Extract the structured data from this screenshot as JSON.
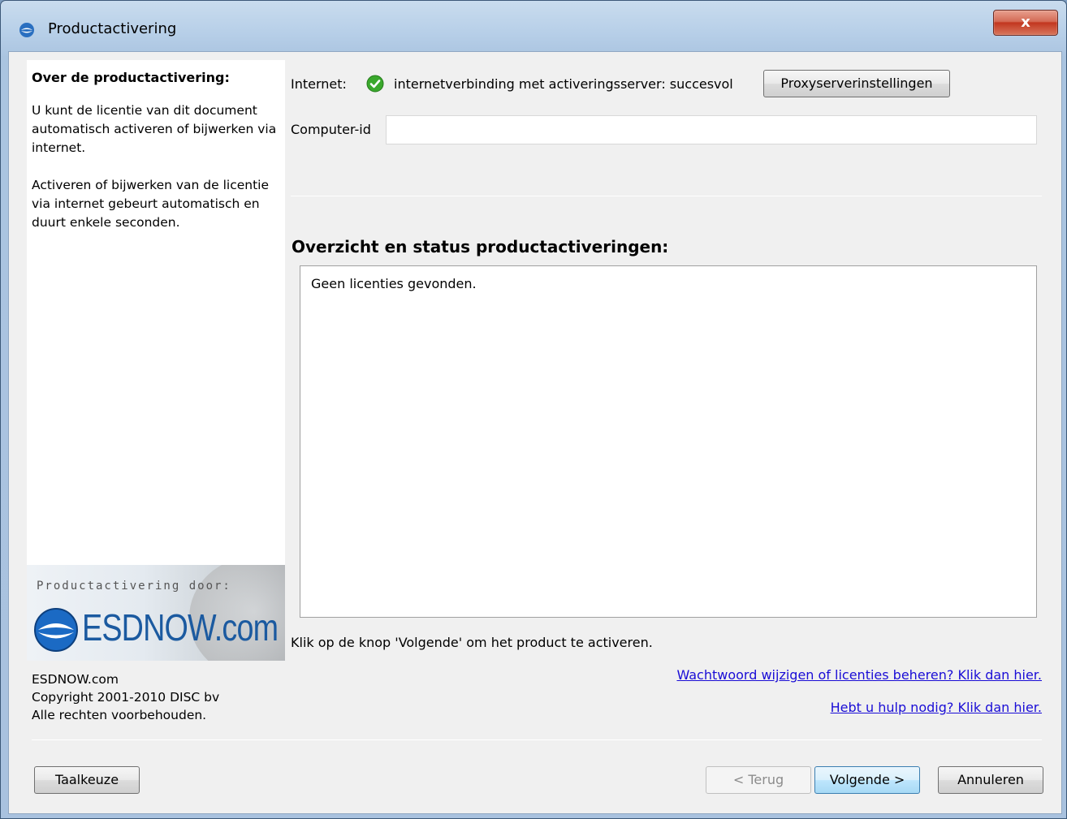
{
  "window": {
    "title": "Productactivering",
    "close_label": "x"
  },
  "left": {
    "heading": "Over de productactivering:",
    "paragraph1": "U kunt de licentie van dit document automatisch activeren of bijwerken via internet.",
    "paragraph2": "Activeren of bijwerken van de licentie via internet gebeurt automatisch en duurt enkele seconden.",
    "logo_caption": "Productactivering door:",
    "logo_text": "ESDNOW.com",
    "copyright_lines": [
      "ESDNOW.com",
      "Copyright 2001-2010 DISC bv",
      "Alle rechten voorbehouden."
    ]
  },
  "internet": {
    "label": "Internet:",
    "status": "internetverbinding met activeringsserver: succesvol",
    "proxy_button": "Proxyserverinstellingen"
  },
  "computer_id": {
    "label": "Computer-id",
    "value": ""
  },
  "overview": {
    "heading": "Overzicht en status productactiveringen:",
    "text": "Geen licenties gevonden."
  },
  "instruction": "Klik op de knop 'Volgende' om het product te activeren.",
  "links": {
    "manage": "Wachtwoord wijzigen of licenties beheren? Klik dan hier.",
    "help": "Hebt u hulp nodig? Klik dan hier."
  },
  "buttons": {
    "language": "Taalkeuze",
    "back": "< Terug",
    "next": "Volgende >",
    "cancel": "Annuleren"
  },
  "colors": {
    "accent": "#1b5aa0",
    "link": "#1a0dd6",
    "success": "#3aa82c"
  }
}
